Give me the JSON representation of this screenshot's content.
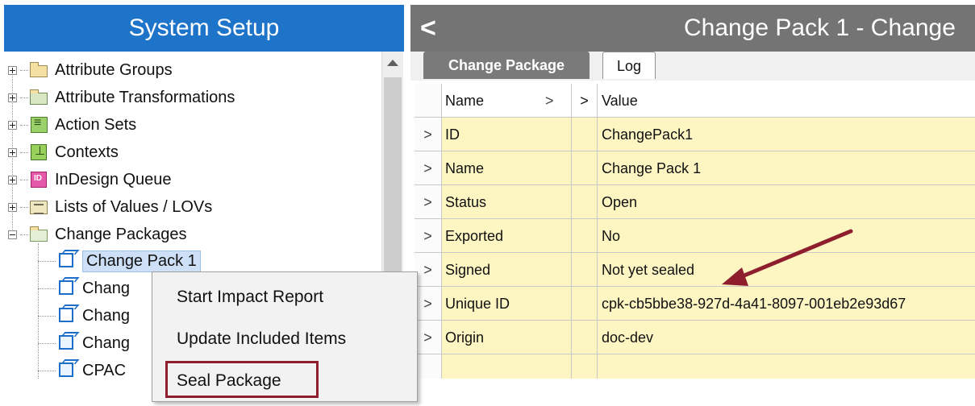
{
  "left_panel": {
    "title": "System Setup",
    "tree": [
      {
        "label": "Attribute Groups",
        "icon": "folder-icon"
      },
      {
        "label": "Attribute Transformations",
        "icon": "transformation-icon"
      },
      {
        "label": "Action Sets",
        "icon": "action-set-icon"
      },
      {
        "label": "Contexts",
        "icon": "context-icon"
      },
      {
        "label": "InDesign Queue",
        "icon": "indesign-icon"
      },
      {
        "label": "Lists of Values / LOVs",
        "icon": "list-icon"
      },
      {
        "label": "Change Packages",
        "icon": "folder-icon"
      },
      {
        "label": "Change Pack 1",
        "icon": "change-pack-icon"
      },
      {
        "label": "Chang",
        "icon": "change-pack-icon"
      },
      {
        "label": "Chang",
        "icon": "change-pack-icon"
      },
      {
        "label": "Chang",
        "icon": "change-pack-icon"
      },
      {
        "label": "CPAC",
        "icon": "change-pack-icon"
      }
    ]
  },
  "context_menu": {
    "items": [
      "Start Impact Report",
      "Update Included Items",
      "Seal Package"
    ],
    "highlight_color": "#8e1d2e"
  },
  "right_panel": {
    "title": "Change Pack 1 - Change",
    "tabs": [
      "Change Package",
      "Log"
    ],
    "columns": {
      "name": "Name",
      "value": "Value",
      "sort_marker": ">"
    },
    "rows": [
      {
        "marker": ">",
        "name": "ID",
        "value": "ChangePack1"
      },
      {
        "marker": ">",
        "name": "Name",
        "value": "Change Pack 1"
      },
      {
        "marker": ">",
        "name": "Status",
        "value": "Open"
      },
      {
        "marker": ">",
        "name": "Exported",
        "value": "No"
      },
      {
        "marker": ">",
        "name": "Signed",
        "value": "Not yet sealed"
      },
      {
        "marker": ">",
        "name": "Unique ID",
        "value": "cpk-cb5bbe38-927d-4a41-8097-001eb2e93d67"
      },
      {
        "marker": ">",
        "name": "Origin",
        "value": "doc-dev"
      }
    ]
  },
  "colors": {
    "left_title_bg": "#1e74c9",
    "right_title_bg": "#747474",
    "row_highlight": "#fdf6c3",
    "annotation_arrow": "#8e1d2e"
  }
}
